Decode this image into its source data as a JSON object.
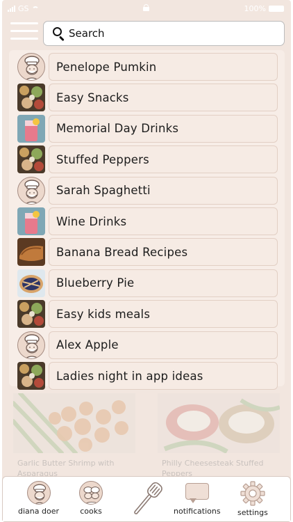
{
  "status_bar": {
    "carrier": "GS",
    "battery": "100%"
  },
  "search": {
    "placeholder": "Search",
    "value": ""
  },
  "list": [
    {
      "label": "Penelope Pumkin",
      "thumb": "chef-avatar"
    },
    {
      "label": "Easy Snacks",
      "thumb": "food-photo"
    },
    {
      "label": "Memorial Day Drinks",
      "thumb": "drink-photo"
    },
    {
      "label": "Stuffed Peppers",
      "thumb": "food-photo"
    },
    {
      "label": "Sarah Spaghetti",
      "thumb": "chef-avatar"
    },
    {
      "label": "Wine Drinks",
      "thumb": "drink-photo"
    },
    {
      "label": "Banana Bread Recipes",
      "thumb": "bread-photo"
    },
    {
      "label": "Blueberry Pie",
      "thumb": "pie-photo"
    },
    {
      "label": "Easy kids meals",
      "thumb": "food-photo"
    },
    {
      "label": "Alex Apple",
      "thumb": "chef-avatar"
    },
    {
      "label": "Ladies night in app ideas",
      "thumb": "food-photo"
    }
  ],
  "cards": [
    {
      "caption": "Garlic Butter Shrimp with Asparagus"
    },
    {
      "caption": "Philly Cheesesteak Stuffed Peppers"
    }
  ],
  "nav": {
    "profile": "diana doer",
    "cooks": "cooks",
    "notifications": "notifications",
    "settings": "settings"
  },
  "colors": {
    "background": "#f2e6df",
    "panel": "#f7ede7",
    "row": "#f6ebe4",
    "avatar": "#ecd8cc"
  }
}
